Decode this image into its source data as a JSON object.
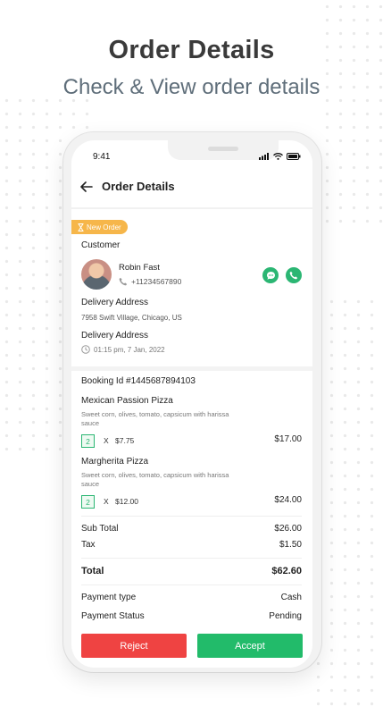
{
  "hero": {
    "title": "Order Details",
    "subtitle": "Check & View order details"
  },
  "status_bar": {
    "time": "9:41"
  },
  "app_bar": {
    "title": "Order Details"
  },
  "order": {
    "badge": "New Order",
    "customer_label": "Customer",
    "customer": {
      "name": "Robin Fast",
      "phone": "+11234567890"
    },
    "delivery_address_label": "Delivery Address",
    "delivery_address": "7958 Swift Village, Chicago, US",
    "delivery_time_label": "Delivery Address",
    "delivery_time": "01:15 pm, 7 Jan, 2022",
    "booking_id": "Booking Id #1445687894103",
    "items": [
      {
        "name": "Mexican Passion Pizza",
        "description": "Sweet corn, olives, tomato, capsicum with harissa sauce",
        "qty": "2",
        "x": "X",
        "unit_price": "$7.75",
        "total": "$17.00"
      },
      {
        "name": "Margherita Pizza",
        "description": "Sweet corn, olives, tomato, capsicum with harissa sauce",
        "qty": "2",
        "x": "X",
        "unit_price": "$12.00",
        "total": "$24.00"
      }
    ],
    "summary": {
      "subtotal_label": "Sub Total",
      "subtotal": "$26.00",
      "tax_label": "Tax",
      "tax": "$1.50",
      "total_label": "Total",
      "total": "$62.60",
      "payment_type_label": "Payment type",
      "payment_type": "Cash",
      "payment_status_label": "Payment Status",
      "payment_status": "Pending"
    },
    "actions": {
      "reject": "Reject",
      "accept": "Accept"
    }
  },
  "colors": {
    "accent_green": "#22bb6a",
    "reject_red": "#ef4342",
    "badge_orange": "#f6b64a"
  },
  "icons": [
    "back-arrow-icon",
    "hourglass-icon",
    "phone-icon",
    "chat-icon",
    "call-icon",
    "clock-icon",
    "signal-icon",
    "wifi-icon",
    "battery-icon"
  ]
}
